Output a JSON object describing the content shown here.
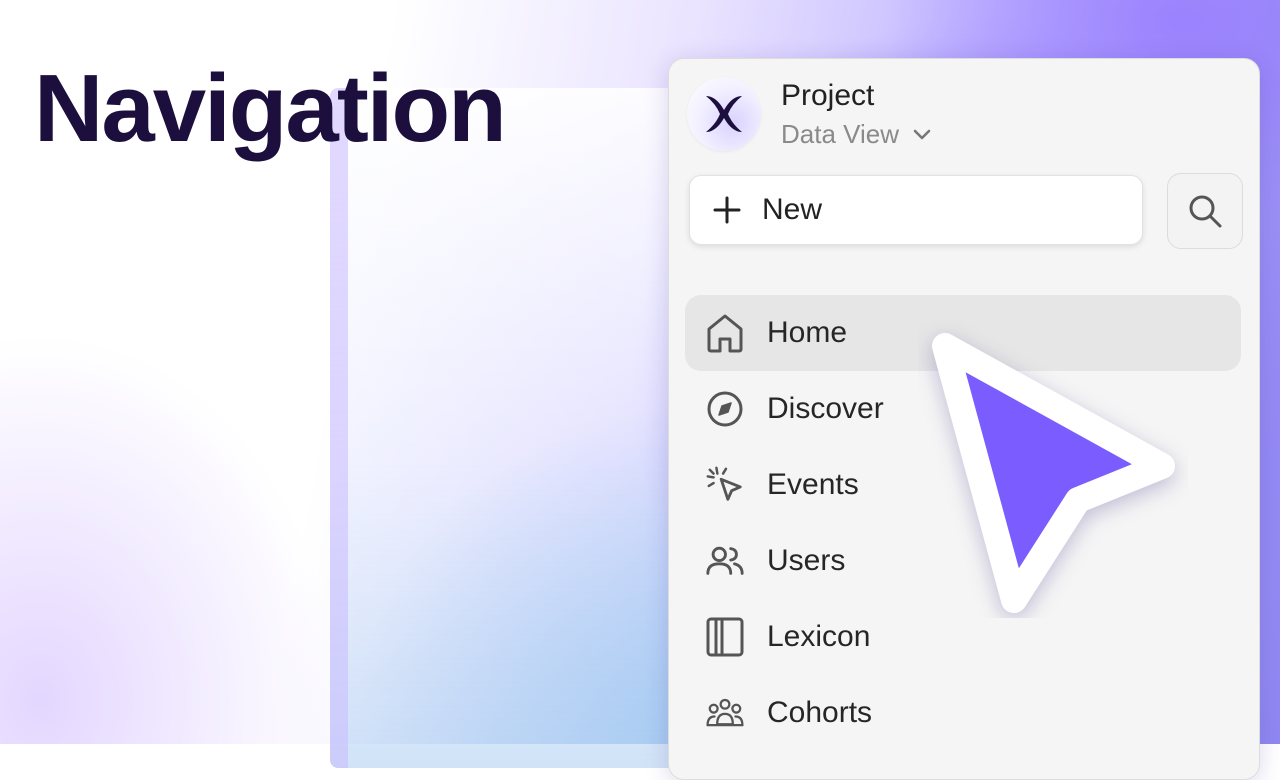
{
  "heading": "Navigation",
  "project": {
    "name": "Project",
    "view": "Data View"
  },
  "actions": {
    "new_label": "New"
  },
  "nav": {
    "items": [
      {
        "label": "Home",
        "icon": "home-icon",
        "active": true
      },
      {
        "label": "Discover",
        "icon": "compass-icon"
      },
      {
        "label": "Events",
        "icon": "click-cursor-icon"
      },
      {
        "label": "Users",
        "icon": "users-icon"
      },
      {
        "label": "Lexicon",
        "icon": "book-icon"
      },
      {
        "label": "Cohorts",
        "icon": "cohorts-icon"
      }
    ]
  },
  "colors": {
    "heading": "#1c0f3e",
    "cursor": "#7a5cff",
    "icon": "#555555"
  }
}
